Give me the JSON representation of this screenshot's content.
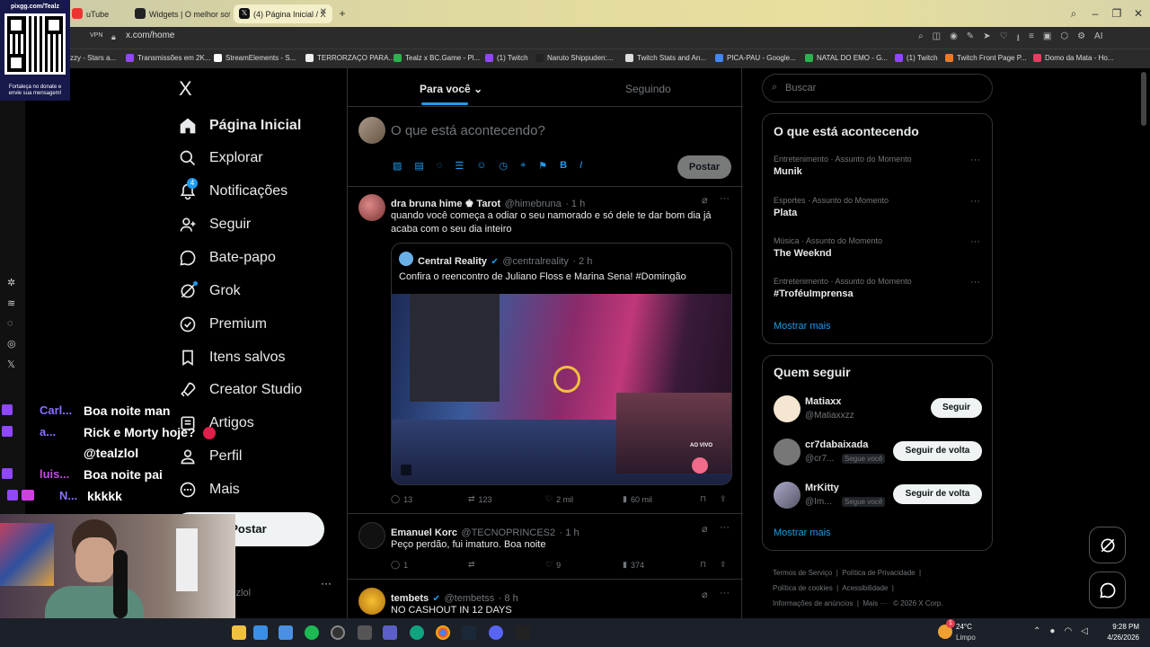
{
  "browser": {
    "tabs": [
      {
        "label": "uTube"
      },
      {
        "label": "Widgets | O melhor soft"
      },
      {
        "label": "(4) Página Inicial / X"
      }
    ],
    "vpn_label": "VPN",
    "url": "x.com/home",
    "ai_label": "AI",
    "bookmarks": [
      "zzy - Stars a...",
      "Transmissões em 2K...",
      "StreamElements - S...",
      "TERRORZAÇO PARA...",
      "Tealz x BC.Game - Pl...",
      "(1) Twitch",
      "Naruto Shippuden:...",
      "Twitch Stats and An...",
      "PICA-PAU - Google...",
      "NATAL DO EMO - G...",
      "(1) Twitch",
      "Twitch Front Page P...",
      "Domo da Mata - Ho..."
    ]
  },
  "overlay": {
    "pix_url": "pixgg.com/Tealz",
    "pix_caption": "Fortaleça no donate e envie sua mensagem!"
  },
  "sidebar": {
    "logo": "X",
    "notification_badge": "4",
    "items": [
      {
        "label": "Página Inicial",
        "icon": "home-icon"
      },
      {
        "label": "Explorar",
        "icon": "search-icon"
      },
      {
        "label": "Notificações",
        "icon": "bell-icon"
      },
      {
        "label": "Seguir",
        "icon": "follow-icon"
      },
      {
        "label": "Bate-papo",
        "icon": "chat-icon"
      },
      {
        "label": "Grok",
        "icon": "grok-icon"
      },
      {
        "label": "Premium",
        "icon": "verified-icon"
      },
      {
        "label": "Itens salvos",
        "icon": "bookmark-icon"
      },
      {
        "label": "Creator Studio",
        "icon": "rocket-icon"
      },
      {
        "label": "Artigos",
        "icon": "article-icon"
      },
      {
        "label": "Perfil",
        "icon": "person-icon"
      },
      {
        "label": "Mais",
        "icon": "more-icon"
      }
    ],
    "post_button": "Postar",
    "account_handle": "alzlol"
  },
  "feed": {
    "tabs": [
      "Para você",
      "Seguindo"
    ],
    "composer_placeholder": "O que está acontecendo?",
    "composer_post": "Postar",
    "tweets": [
      {
        "name": "dra bruna hime ♚ Tarot",
        "handle": "@himebruna",
        "time": "· 1 h",
        "text": "quando você começa a odiar o seu namorado e só dele te dar bom dia já acaba com o seu dia inteiro",
        "quote": {
          "name": "Central Reality",
          "handle": "@centralreality",
          "time": "· 2 h",
          "text": "Confira o reencontro de Juliano Floss e Marina Sena! #Domingão",
          "badge": "AO VIVO"
        },
        "replies": "13",
        "retweets": "123",
        "likes": "2 mil",
        "views": "60 mil"
      },
      {
        "name": "Emanuel Korc",
        "handle": "@TECNOPRINCES2",
        "time": "· 1 h",
        "text": "Peço perdão, fui imaturo. Boa noite",
        "replies": "1",
        "retweets": "",
        "likes": "9",
        "views": "374"
      },
      {
        "name": "tembets",
        "handle": "@tembetss",
        "time": "· 8 h",
        "text": "NO CASHOUT IN 12 DAYS"
      }
    ]
  },
  "right": {
    "search_placeholder": "Buscar",
    "trends_title": "O que está acontecendo",
    "trends": [
      {
        "category": "Entretenimento · Assunto do Momento",
        "title": "Munik"
      },
      {
        "category": "Esportes · Assunto do Momento",
        "title": "Plata"
      },
      {
        "category": "Música · Assunto do Momento",
        "title": "The Weeknd"
      },
      {
        "category": "Entretenimento · Assunto do Momento",
        "title": "#TroféuImprensa"
      }
    ],
    "show_more": "Mostrar mais",
    "who_title": "Quem seguir",
    "who": [
      {
        "name": "Matiaxx",
        "handle": "@Matiaxxzz",
        "button": "Seguir",
        "follows_you": ""
      },
      {
        "name": "cr7dabaixada",
        "handle": "@cr7...",
        "button": "Seguir de volta",
        "follows_you": "Segue você"
      },
      {
        "name": "MrKitty",
        "handle": "@Im...",
        "button": "Seguir de volta",
        "follows_you": "Segue você"
      }
    ],
    "footer": [
      "Termos de Serviço",
      "Política de Privacidade",
      "Política de cookies",
      "Acessibilidade",
      "Informações de anúncios",
      "Mais ···",
      "© 2026 X Corp."
    ]
  },
  "chat": [
    {
      "name": "Carl...",
      "message": "Boa noite man",
      "color": "#8a6fff"
    },
    {
      "name": "a...",
      "message": "Rick e Morty hoje?",
      "color": "#8a6fff"
    },
    {
      "name": "",
      "message": "@tealzlol",
      "color": "#8a6fff"
    },
    {
      "name": "luis...",
      "message": "Boa noite pai",
      "color": "#c04de0"
    },
    {
      "name": "N...",
      "message": "kkkkk",
      "color": "#8a6fff"
    }
  ],
  "taskbar": {
    "weather_temp": "24°C",
    "weather_desc": "Limpo",
    "weather_badge": "1",
    "time": "9:28 PM",
    "date": "4/26/2026"
  },
  "colors": {
    "accent": "#1d9bf0",
    "background": "#000000",
    "border": "#2f3336",
    "muted": "#71767b"
  }
}
